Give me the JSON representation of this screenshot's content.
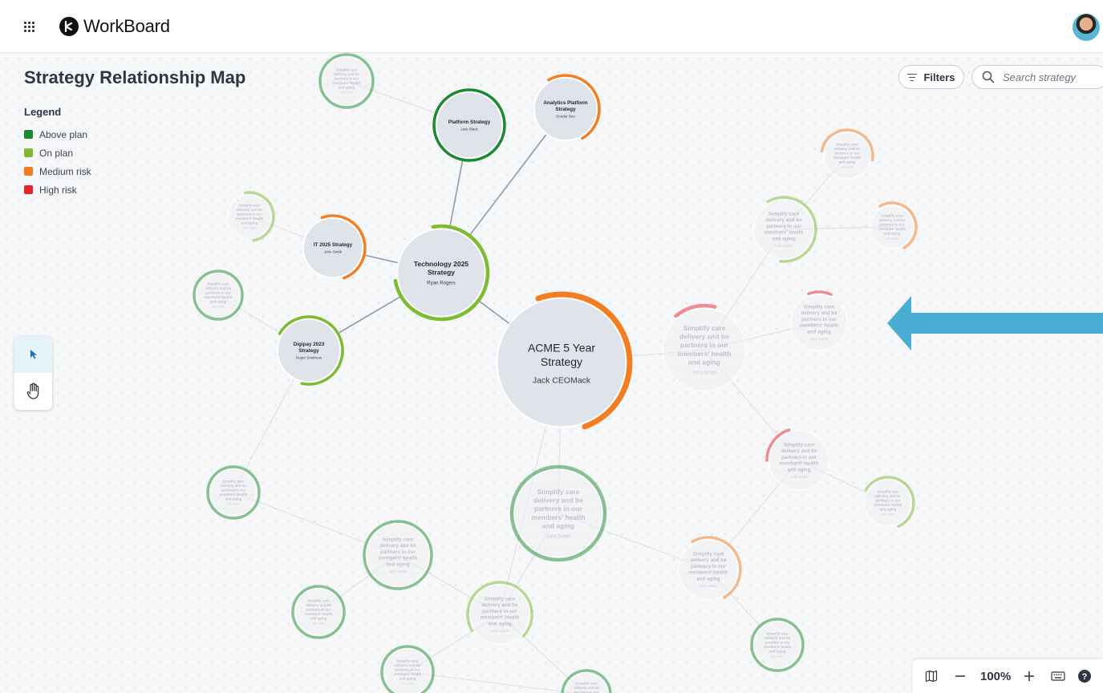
{
  "app": {
    "name": "WorkBoard"
  },
  "page": {
    "title": "Strategy Relationship Map"
  },
  "legend": {
    "title": "Legend",
    "items": [
      {
        "label": "Above plan",
        "color": "#1a8a2e"
      },
      {
        "label": "On plan",
        "color": "#7dbb2f"
      },
      {
        "label": "Medium risk",
        "color": "#f47d1f"
      },
      {
        "label": "High risk",
        "color": "#e8232e"
      }
    ]
  },
  "toolbar": {
    "filters_label": "Filters",
    "search_placeholder": "Search strategy"
  },
  "tools": [
    {
      "name": "select",
      "icon": "pointer-icon",
      "active": true
    },
    {
      "name": "pan",
      "icon": "hand-icon",
      "active": false
    }
  ],
  "zoom": {
    "level": "100%"
  },
  "colors": {
    "above": "#1a8a2e",
    "on": "#7dbb2f",
    "medium": "#f47d1f",
    "high": "#e8232e",
    "link": "#8d9bb0",
    "arrow": "#4aaed4"
  },
  "map": {
    "nodes": [
      {
        "id": "acme",
        "lines": [
          "ACME 5 Year",
          "Strategy"
        ],
        "owner": "Jack CEOMack",
        "status": "medium",
        "progress": 0.5,
        "faded": false
      },
      {
        "id": "tech",
        "lines": [
          "Technology 2025",
          "Strategy"
        ],
        "owner": "Ryan Rogers",
        "status": "on",
        "progress": 0.75,
        "faded": false
      },
      {
        "id": "platform",
        "lines": [
          "Platform Strategy"
        ],
        "owner": "Jack Black",
        "status": "above",
        "progress": 1.0,
        "faded": false
      },
      {
        "id": "analytics",
        "lines": [
          "Analytics Platform",
          "Strategy"
        ],
        "owner": "Sundar Boo",
        "status": "medium",
        "progress": 0.5,
        "faded": false
      },
      {
        "id": "it2025",
        "lines": [
          "IT 2025 Strategy"
        ],
        "owner": "John Smith",
        "status": "medium",
        "progress": 0.5,
        "faded": false
      },
      {
        "id": "digipay",
        "lines": [
          "Digipay 2023",
          "Strategy"
        ],
        "owner": "Roger Smithrow",
        "status": "on",
        "progress": 0.7,
        "faded": false
      },
      {
        "id": "s1",
        "lines": [
          "Simplify care",
          "delivery and be",
          "partners in our",
          "members' health",
          "and aging"
        ],
        "owner": "John Smith",
        "status": "above",
        "progress": 1.0,
        "faded": true
      },
      {
        "id": "s2",
        "lines": [
          "Simplify care",
          "delivery and be",
          "partners in our",
          "members' health",
          "and aging"
        ],
        "owner": "John Smith",
        "status": "high",
        "progress": 0.15,
        "faded": true
      },
      {
        "id": "s3",
        "lines": [
          "Simplify care",
          "delivery and be",
          "partners in our",
          "members' health",
          "and aging"
        ],
        "owner": "John Smith",
        "status": "on",
        "progress": 0.5,
        "faded": true
      },
      {
        "id": "s4",
        "lines": [
          "Simplify care",
          "delivery and be",
          "partners in our",
          "members' health",
          "and aging"
        ],
        "owner": "John Smith",
        "status": "above",
        "progress": 1.0,
        "faded": true
      },
      {
        "id": "s5",
        "lines": [
          "Simplify care",
          "delivery and be",
          "partners in our",
          "members' health",
          "and aging"
        ],
        "owner": "John Smith",
        "status": "high",
        "progress": 0.12,
        "faded": true
      },
      {
        "id": "s6",
        "lines": [
          "Simplify care",
          "delivery and be",
          "partners in our",
          "members' health",
          "and aging"
        ],
        "owner": "John Smith",
        "status": "on",
        "progress": 0.6,
        "faded": true
      },
      {
        "id": "s7",
        "lines": [
          "Simplify care",
          "delivery and be",
          "partners in our",
          "members' health",
          "and aging"
        ],
        "owner": "John Smith",
        "status": "medium",
        "progress": 0.5,
        "faded": true
      },
      {
        "id": "s8",
        "lines": [
          "Simplify care",
          "delivery and be",
          "partners in our",
          "members' health",
          "and aging"
        ],
        "owner": "John Smith",
        "status": "medium",
        "progress": 0.5,
        "faded": true
      },
      {
        "id": "s9",
        "lines": [
          "Simplify care",
          "delivery and be",
          "partners in our",
          "members' health",
          "and aging"
        ],
        "owner": "John Smith",
        "status": "high",
        "progress": 0.2,
        "faded": true
      },
      {
        "id": "s10",
        "lines": [
          "Simplify care",
          "delivery and be",
          "partners in our",
          "members' health",
          "and aging"
        ],
        "owner": "John Smith",
        "status": "on",
        "progress": 0.6,
        "faded": true
      },
      {
        "id": "s11",
        "lines": [
          "Simplify care",
          "delivery and be",
          "partners in our",
          "members' health",
          "and aging"
        ],
        "owner": "John Smith",
        "status": "above",
        "progress": 1.0,
        "faded": true
      },
      {
        "id": "s12",
        "lines": [
          "Simplify care",
          "delivery and be",
          "partners in our",
          "members' health",
          "and aging"
        ],
        "owner": "John Smith",
        "status": "above",
        "progress": 1.0,
        "faded": true
      },
      {
        "id": "s13",
        "lines": [
          "Simplify care",
          "delivery and be",
          "partners in our",
          "members' health",
          "and aging"
        ],
        "owner": "John Smith",
        "status": "above",
        "progress": 1.0,
        "faded": true
      },
      {
        "id": "s14",
        "lines": [
          "Simplify care",
          "delivery and be",
          "partners in our",
          "members' health",
          "and aging"
        ],
        "owner": "John Smith",
        "status": "on",
        "progress": 0.7,
        "faded": true
      },
      {
        "id": "s15",
        "lines": [
          "Simplify care",
          "delivery and be",
          "partners in our",
          "members' health",
          "and aging"
        ],
        "owner": "John Smith",
        "status": "medium",
        "progress": 0.5,
        "faded": true
      },
      {
        "id": "s16",
        "lines": [
          "Simplify care",
          "delivery and be",
          "partners in our",
          "members' health",
          "and aging"
        ],
        "owner": "John Smith",
        "status": "above",
        "progress": 1.0,
        "faded": true
      },
      {
        "id": "s17",
        "lines": [
          "Simplify care",
          "delivery and be",
          "partners in our",
          "members' health",
          "and aging"
        ],
        "owner": "John Smith",
        "status": "above",
        "progress": 1.0,
        "faded": true
      },
      {
        "id": "s18",
        "lines": [
          "Simplify care",
          "delivery and be",
          "partners in our",
          "members' health",
          "and aging"
        ],
        "owner": "John Smith",
        "status": "above",
        "progress": 1.0,
        "faded": true
      },
      {
        "id": "s19",
        "lines": [
          "Simplify care",
          "delivery and be",
          "partners in our",
          "members' health",
          "and aging"
        ],
        "owner": "John Smith",
        "status": "above",
        "progress": 1.0,
        "faded": true
      },
      {
        "id": "s20",
        "lines": [
          "Simplify care"
        ],
        "owner": "",
        "status": "on",
        "progress": 0.3,
        "faded": true
      }
    ],
    "links": [
      [
        "acme",
        "tech"
      ],
      [
        "acme",
        "s2"
      ],
      [
        "acme",
        "s11"
      ],
      [
        "acme",
        "s14"
      ],
      [
        "tech",
        "platform"
      ],
      [
        "tech",
        "analytics"
      ],
      [
        "tech",
        "it2025"
      ],
      [
        "tech",
        "digipay"
      ],
      [
        "it2025",
        "s3"
      ],
      [
        "digipay",
        "s4"
      ],
      [
        "digipay",
        "s12"
      ],
      [
        "s1",
        "platform"
      ],
      [
        "s2",
        "s5"
      ],
      [
        "s2",
        "s6"
      ],
      [
        "s2",
        "s9"
      ],
      [
        "s6",
        "s7"
      ],
      [
        "s6",
        "s8"
      ],
      [
        "s9",
        "s10"
      ],
      [
        "s9",
        "s15"
      ],
      [
        "s15",
        "s16"
      ],
      [
        "s11",
        "s15"
      ],
      [
        "s11",
        "s14"
      ],
      [
        "s12",
        "s13"
      ],
      [
        "s13",
        "s14"
      ],
      [
        "s13",
        "s17"
      ],
      [
        "s14",
        "s18"
      ],
      [
        "s18",
        "s19"
      ],
      [
        "s14",
        "s20"
      ]
    ]
  }
}
